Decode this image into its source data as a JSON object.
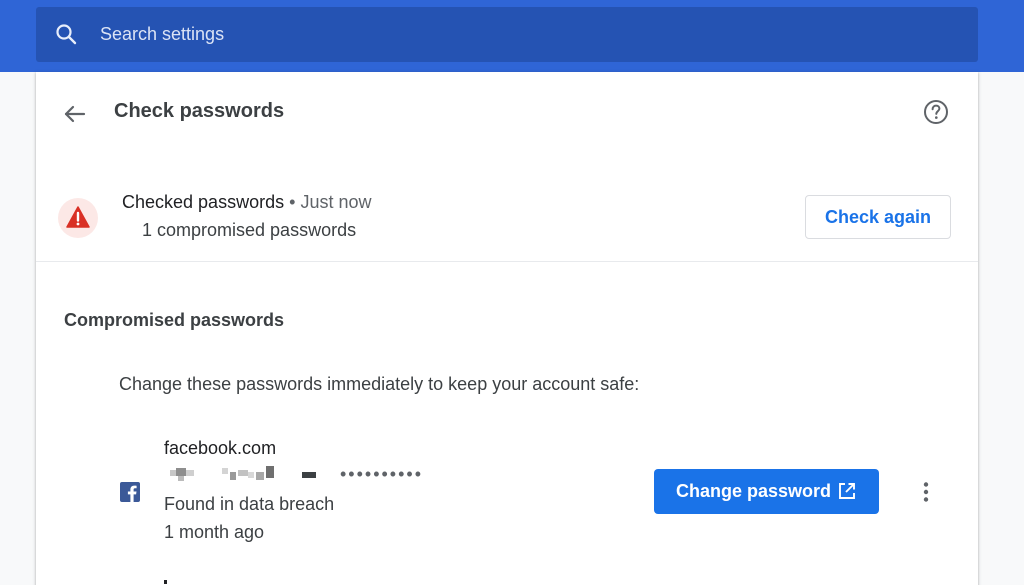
{
  "search": {
    "placeholder": "Search settings",
    "icon": "search-icon"
  },
  "header": {
    "title": "Check passwords",
    "back_icon": "arrow-back-icon",
    "help_icon": "help-circle-icon"
  },
  "status": {
    "title": "Checked passwords",
    "separator": "•",
    "time": "Just now",
    "subtitle": "1 compromised passwords",
    "icon": "warning-triangle-icon",
    "check_again_label": "Check again"
  },
  "compromised": {
    "heading": "Compromised passwords",
    "description": "Change these passwords immediately to keep your account safe:",
    "items": [
      {
        "site": "facebook.com",
        "password_mask": "••••••••••",
        "status": "Found in data breach",
        "age": "1 month ago",
        "action_label": "Change password",
        "site_icon": "facebook-icon",
        "action_icon": "open-in-new-icon",
        "menu_icon": "more-vert-icon"
      }
    ]
  },
  "colors": {
    "topbar": "#2f65d6",
    "search_bg": "#2553b3",
    "accent": "#1a73e8",
    "warning": "#d93025",
    "warning_bg": "#fce8e6",
    "facebook": "#3b5998"
  }
}
